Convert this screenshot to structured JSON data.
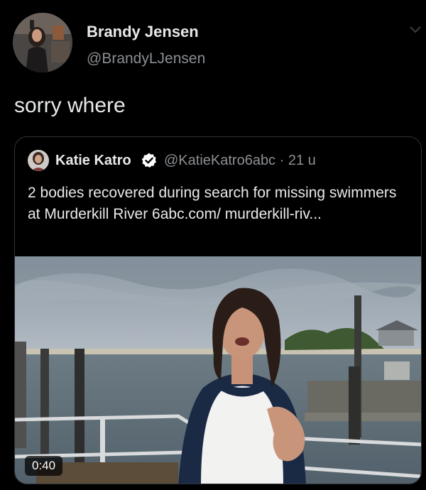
{
  "tweet": {
    "display_name": "Brandy Jensen",
    "handle": "@BrandyLJensen",
    "text": "sorry where"
  },
  "quoted_tweet": {
    "display_name": "Katie Katro",
    "handle_and_time": "@KatieKatro6abc · 21 u",
    "text": "2 bodies recovered during search for missing swimmers at Murderkill River 6abc.com/ murderkill-riv...",
    "video_duration": "0:40"
  },
  "icons": {
    "menu": "chevron-down-icon",
    "verified": "verified-badge-icon"
  },
  "colors": {
    "background": "#000000",
    "text": "#e7e9ea",
    "muted": "#8b8f93",
    "border": "#2f3336"
  }
}
